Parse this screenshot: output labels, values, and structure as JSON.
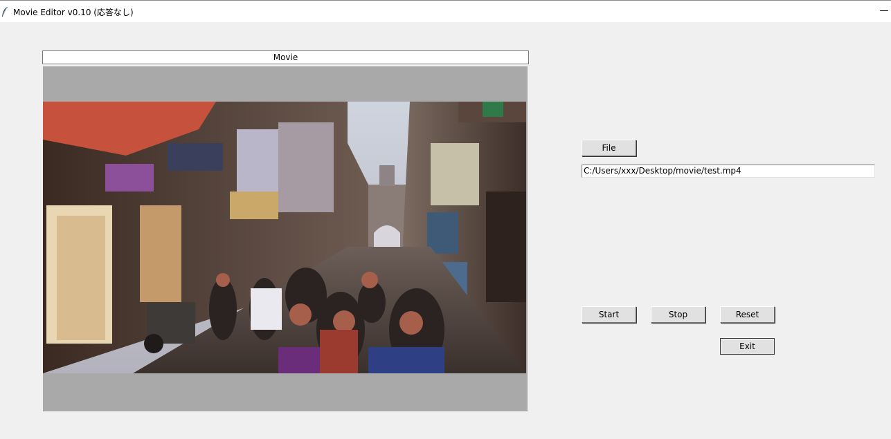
{
  "window": {
    "title": "Movie Editor v0.10 (応答なし)",
    "minimize_glyph": "—",
    "icon": "feather-icon"
  },
  "movie_panel": {
    "label": "Movie",
    "video_description": ""
  },
  "controls": {
    "file_label": "File",
    "file_path": "C:/Users/xxx/Desktop/movie/test.mp4",
    "start_label": "Start",
    "stop_label": "Stop",
    "reset_label": "Reset",
    "exit_label": "Exit"
  },
  "colors": {
    "background": "#f0f0f0",
    "canvas_bg": "#a9a9a9",
    "button_face": "#e1e1e1"
  }
}
